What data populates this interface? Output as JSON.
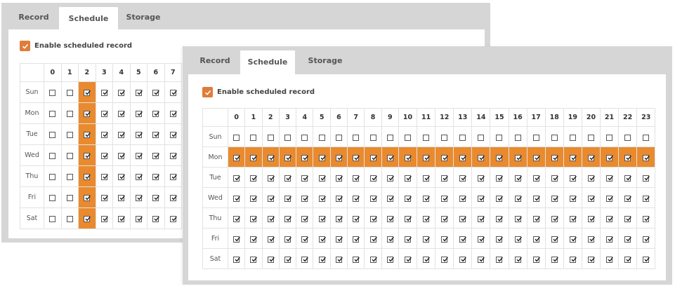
{
  "hours": [
    "0",
    "1",
    "2",
    "3",
    "4",
    "5",
    "6",
    "7",
    "8",
    "9",
    "10",
    "11",
    "12",
    "13",
    "14",
    "15",
    "16",
    "17",
    "18",
    "19",
    "20",
    "21",
    "22",
    "23"
  ],
  "days": [
    "Sun",
    "Mon",
    "Tue",
    "Wed",
    "Thu",
    "Fri",
    "Sat"
  ],
  "colors": {
    "accent": "#ea8a2e",
    "checkbox_accent": "#e07c39",
    "panel_bg": "#d6d6d6"
  },
  "back_panel": {
    "tabs": [
      {
        "label": "Record",
        "active": false
      },
      {
        "label": "Schedule",
        "active": true
      },
      {
        "label": "Storage",
        "active": false
      }
    ],
    "enable_label": "Enable scheduled record",
    "enable_checked": true,
    "visible_hours": 8,
    "highlight_column": 2,
    "unchecked_hours": [
      0,
      1
    ]
  },
  "front_panel": {
    "tabs": [
      {
        "label": "Record",
        "active": false
      },
      {
        "label": "Schedule",
        "active": true
      },
      {
        "label": "Storage",
        "active": false
      }
    ],
    "enable_label": "Enable scheduled record",
    "enable_checked": true,
    "visible_hours": 24,
    "highlight_row": "Mon",
    "unchecked_rows": [
      "Sun"
    ]
  }
}
